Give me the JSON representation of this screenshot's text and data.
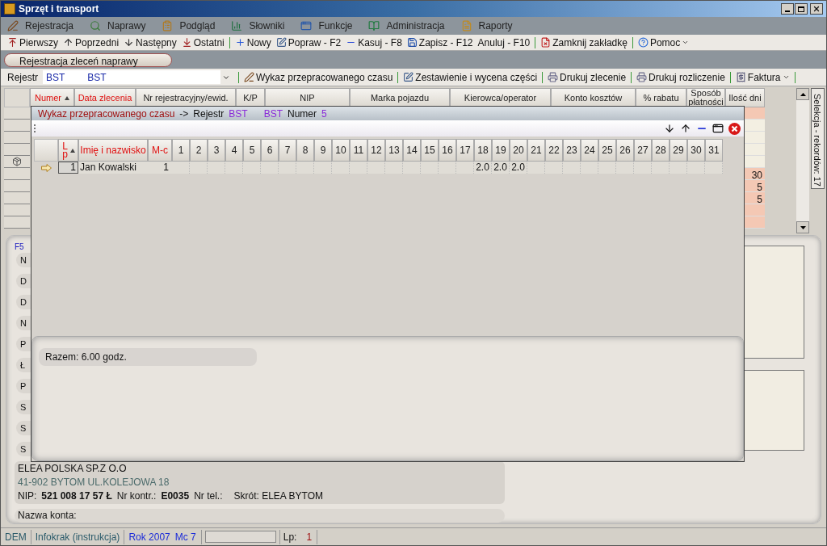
{
  "window": {
    "title": "Sprzęt i transport"
  },
  "menu": [
    {
      "label": "Rejestracja",
      "kind": "pen"
    },
    {
      "label": "Naprawy",
      "kind": "wrench"
    },
    {
      "label": "Podgląd",
      "kind": "clipboard"
    },
    {
      "label": "Słowniki",
      "kind": "chart"
    },
    {
      "label": "Funkcje",
      "kind": "window"
    },
    {
      "label": "Administracja",
      "kind": "book"
    },
    {
      "label": "Raporty",
      "kind": "report"
    }
  ],
  "toolbar": [
    {
      "label": "Pierwszy",
      "kind": "first",
      "separator_after": false,
      "dropdown": false
    },
    {
      "label": "Poprzedni",
      "kind": "up",
      "separator_after": false,
      "dropdown": false
    },
    {
      "label": "Następny",
      "kind": "down",
      "separator_after": false,
      "dropdown": false
    },
    {
      "label": "Ostatni",
      "kind": "last",
      "separator_after": true,
      "dropdown": false
    },
    {
      "label": "Nowy",
      "kind": "plus",
      "separator_after": false,
      "dropdown": false
    },
    {
      "label": "Popraw - F2",
      "kind": "edit",
      "separator_after": false,
      "dropdown": false
    },
    {
      "label": "Kasuj - F8",
      "kind": "minus",
      "separator_after": false,
      "dropdown": false
    },
    {
      "label": "Zapisz - F12",
      "kind": "save",
      "separator_after": false,
      "dropdown": false
    },
    {
      "label": "Anuluj - F10",
      "kind": "none",
      "separator_after": true,
      "dropdown": false
    },
    {
      "label": "Zamknij zakładkę",
      "kind": "closedoc",
      "separator_after": true,
      "dropdown": false
    },
    {
      "label": "Pomoc",
      "kind": "help",
      "separator_after": false,
      "dropdown": true
    }
  ],
  "document_tab": {
    "label": "Rejestracja zleceń naprawy"
  },
  "register": {
    "label": "Rejestr",
    "code": "BST",
    "name": "BST"
  },
  "register_toolbar": [
    {
      "label": "Wykaz przepracowanego czasu",
      "kind": "pen",
      "dropdown": false
    },
    {
      "label": "Zestawienie i wycena części",
      "kind": "edit",
      "dropdown": false
    },
    {
      "label": "Drukuj zlecenie",
      "kind": "print",
      "dropdown": false
    },
    {
      "label": "Drukuj rozliczenie",
      "kind": "print",
      "dropdown": false
    },
    {
      "label": "Faktura",
      "kind": "invoice",
      "dropdown": true
    }
  ],
  "table": {
    "columns": [
      {
        "label": "Numer",
        "required": true,
        "sorted": true
      },
      {
        "label": "Data zlecenia",
        "required": true,
        "sorted": false
      },
      {
        "label": "Nr rejestracyjny/ewid.",
        "required": false,
        "sorted": false
      },
      {
        "label": "K/P",
        "required": false,
        "sorted": false
      },
      {
        "label": "NIP",
        "required": false,
        "sorted": false
      },
      {
        "label": "Marka pojazdu",
        "required": false,
        "sorted": false
      },
      {
        "label": "Kierowca/operator",
        "required": false,
        "sorted": false
      },
      {
        "label": "Konto kosztów",
        "required": false,
        "sorted": false
      },
      {
        "label": "% rabatu",
        "required": false,
        "sorted": false
      },
      {
        "label": "Sposób płatności",
        "required": false,
        "sorted": false
      },
      {
        "label": "Ilość dni",
        "required": false,
        "sorted": false
      }
    ],
    "rows": [
      {
        "current": false,
        "shaded": true
      },
      {
        "current": false,
        "shaded": false
      },
      {
        "current": false,
        "shaded": false
      },
      {
        "current": false,
        "shaded": false
      },
      {
        "current": true,
        "shaded": false
      },
      {
        "current": false,
        "shaded": true,
        "days": "30"
      },
      {
        "current": false,
        "shaded": true,
        "days": "5"
      },
      {
        "current": false,
        "shaded": true,
        "days": "5"
      },
      {
        "current": false,
        "shaded": true
      },
      {
        "current": false,
        "shaded": true
      }
    ]
  },
  "side_tab": {
    "label": "Selekcja - rekordów: 17"
  },
  "form": {
    "hotkey": "F5",
    "labels": [
      "N",
      "D",
      "D",
      "N",
      "P",
      "Ł",
      "P",
      "S",
      "S",
      "S"
    ],
    "company": "ELEA POLSKA SP.Z O.O",
    "address": "41-902  BYTOM  UL.KOLEJOWA 18",
    "nip_label": "NIP:",
    "nip": "521 008 17 57 Ł",
    "contractor_label": "Nr kontr.:",
    "contractor": "E0035",
    "phone_label": "Nr tel.:",
    "short_name": "Skrót: ELEA BYTOM",
    "account_label": "Nazwa konta:"
  },
  "popup": {
    "title": "Wykaz przepracowanego czasu",
    "arrow": "->",
    "register_label": "Rejestr",
    "register_code": "BST",
    "register_name": "BST",
    "number_label": "Numer",
    "number": "5",
    "columns": [
      {
        "label": "L p",
        "required": true,
        "sorted": true
      },
      {
        "label": "Imię i nazwisko",
        "required": true,
        "sorted": false
      },
      {
        "label": "M-c",
        "required": true,
        "sorted": false
      }
    ],
    "day_columns": [
      {
        "label": "1"
      },
      {
        "label": "2"
      },
      {
        "label": "3"
      },
      {
        "label": "4"
      },
      {
        "label": "5"
      },
      {
        "label": "6"
      },
      {
        "label": "7"
      },
      {
        "label": "8"
      },
      {
        "label": "9"
      },
      {
        "label": "10"
      },
      {
        "label": "11"
      },
      {
        "label": "12"
      },
      {
        "label": "13"
      },
      {
        "label": "14"
      },
      {
        "label": "15"
      },
      {
        "label": "16"
      },
      {
        "label": "17"
      },
      {
        "label": "18",
        "hours": [
          "2.0"
        ]
      },
      {
        "label": "19",
        "hours": [
          "2.0"
        ]
      },
      {
        "label": "20",
        "hours": [
          "2.0"
        ]
      },
      {
        "label": "21"
      },
      {
        "label": "22"
      },
      {
        "label": "23"
      },
      {
        "label": "24"
      },
      {
        "label": "25"
      },
      {
        "label": "26"
      },
      {
        "label": "27"
      },
      {
        "label": "28"
      },
      {
        "label": "29"
      },
      {
        "label": "30"
      },
      {
        "label": "31"
      }
    ],
    "rows": [
      {
        "current": true,
        "lp": "1",
        "name": "Jan Kowalski",
        "month": "1"
      }
    ],
    "total": "Razem: 6.00 godz."
  },
  "status_bar": {
    "mode": "DEM",
    "company": "Infokrak (instrukcja)",
    "year": "Rok 2007",
    "month": "Mc 7",
    "lp_label": "Lp:",
    "lp": "1"
  }
}
